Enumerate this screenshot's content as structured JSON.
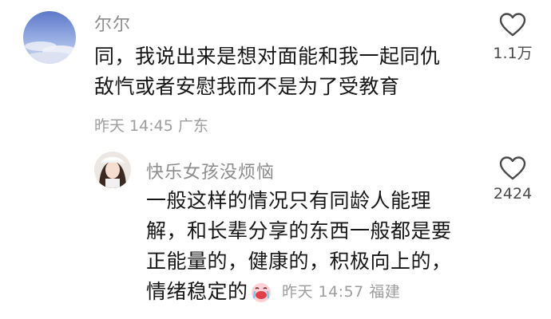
{
  "comments": [
    {
      "username": "尔尔",
      "lines": [
        "同，我说出来是想对面能和我一起同仇",
        "敌忾或者安慰我而不是为了受教育"
      ],
      "time": "昨天 14:45",
      "location": "广东",
      "likes": "1.1万",
      "avatar_icon": "sky-cloud-avatar",
      "like_icon": "heart-outline-icon"
    },
    {
      "username": "快乐女孩没烦恼",
      "lines": [
        "一般这样的情况只有同龄人能理",
        "解，和长辈分享的东西一般都是要",
        "正能量的，健康的，积极向上的，",
        "情绪稳定的"
      ],
      "emoji_icon": "crying-face-emoji-icon",
      "time": "昨天 14:57",
      "location": "福建",
      "likes": "2424",
      "avatar_icon": "girl-portrait-avatar",
      "like_icon": "heart-outline-icon"
    }
  ],
  "colors": {
    "username": "#8c8c8c",
    "text": "#161616",
    "meta": "#9d9d9d",
    "like_count": "#4a4a4a"
  }
}
